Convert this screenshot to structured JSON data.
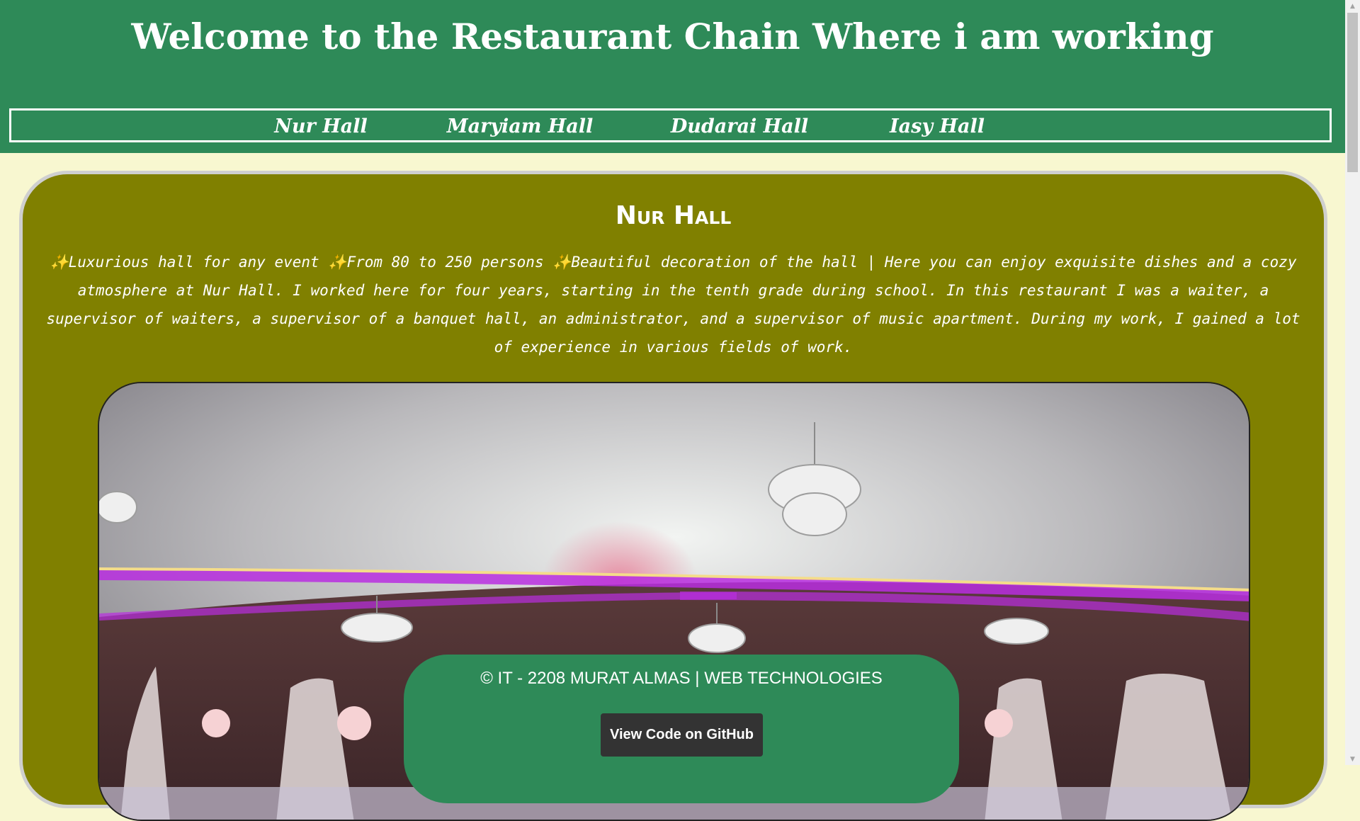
{
  "header": {
    "title": "Welcome to the Restaurant Chain Where i am working"
  },
  "nav": {
    "items": [
      {
        "label": "Nur Hall"
      },
      {
        "label": "Maryiam Hall"
      },
      {
        "label": "Dudarai Hall"
      },
      {
        "label": "Iasy Hall"
      }
    ]
  },
  "section": {
    "title": "Nur Hall",
    "description": "✨Luxurious hall for any event ✨From 80 to 250 persons ✨Beautiful decoration of the hall | Here you can enjoy exquisite dishes and a cozy atmosphere at Nur Hall. I worked here for four years, starting in the tenth grade during school. In this restaurant I was a waiter, a supervisor of waiters, a supervisor of a banquet hall, an administrator, and a supervisor of music apartment. During my work, I gained a lot of experience in various fields of work."
  },
  "footer": {
    "copyright": "© IT - 2208 MURAT ALMAS | WEB TECHNOLOGIES",
    "github_label": "View Code on GitHub"
  },
  "colors": {
    "header_bg": "#2e8a58",
    "page_bg": "#f8f7d0",
    "card_bg": "#808000",
    "button_bg": "#333333"
  }
}
